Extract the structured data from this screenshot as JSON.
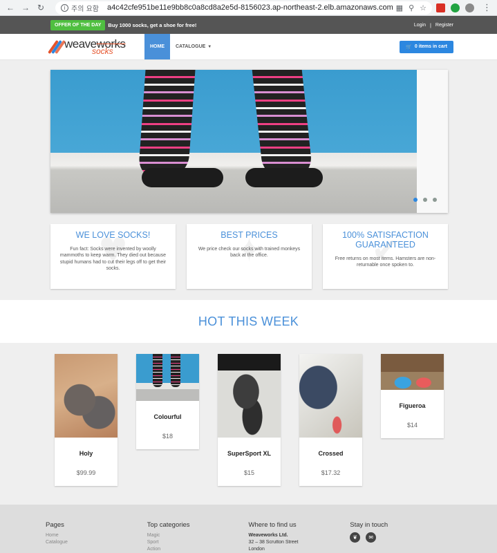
{
  "browser": {
    "security_label": "주의 요함",
    "url": "a4c42cfe951be11e9bb8c0a8cd8a2e5d-8156023.ap-northeast-2.elb.amazonaws.com"
  },
  "topbar": {
    "offer_badge": "OFFER OF THE DAY",
    "offer_text": "Buy 1000 socks, get a shoe for free!",
    "login": "Login",
    "separator": "|",
    "register": "Register"
  },
  "navbar": {
    "logo_weave": "weave",
    "logo_works": "works",
    "logo_socks": "socks",
    "home": "HOME",
    "catalogue": "CATALOGUE",
    "cart": "0 items in cart"
  },
  "hero": {
    "slides": 3,
    "active_slide": 1
  },
  "features": [
    {
      "title": "WE LOVE SOCKS!",
      "text": "Fun fact: Socks were invented by woolly mammoths to keep warm. They died out because stupid humans had to cut their legs off to get their socks."
    },
    {
      "title": "BEST PRICES",
      "text": "We price check our socks with trained monkeys back at the office."
    },
    {
      "title": "100% SATISFACTION GUARANTEED",
      "text": "Free returns on most items. Hamsters are non-returnable once spoken to."
    }
  ],
  "hot": {
    "title": "HOT THIS WEEK"
  },
  "products": [
    {
      "name": "Holy",
      "price": "$99.99"
    },
    {
      "name": "Colourful",
      "price": "$18"
    },
    {
      "name": "SuperSport XL",
      "price": "$15"
    },
    {
      "name": "Crossed",
      "price": "$17.32"
    },
    {
      "name": "Figueroa",
      "price": "$14"
    }
  ],
  "footer": {
    "pages": {
      "title": "Pages",
      "links": [
        "Home",
        "Catalogue"
      ]
    },
    "categories": {
      "title": "Top categories",
      "links": [
        "Magic",
        "Sport",
        "Action"
      ]
    },
    "where": {
      "title": "Where to find us",
      "company": "Weaveworks Ltd.",
      "address": [
        "32 – 38 Scrutton Street",
        "London"
      ]
    },
    "touch": {
      "title": "Stay in touch"
    }
  },
  "colors": {
    "accent": "#4a90d9",
    "cart_button": "#2c87e0",
    "offer_green": "#4fbf40",
    "logo_orange": "#e5532b"
  }
}
